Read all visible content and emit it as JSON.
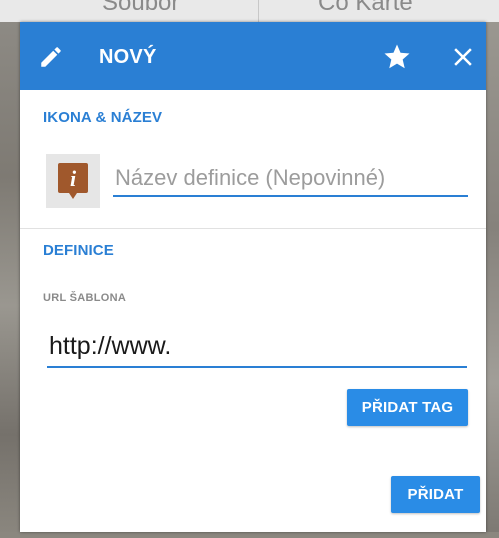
{
  "background": {
    "tab_left": "Soubor",
    "tab_right": "Co Karte"
  },
  "dialog": {
    "title": "NOVÝ",
    "header_icons": {
      "edit": "pencil-icon",
      "favorite": "star-icon",
      "close": "close-icon"
    },
    "icon_and_name": {
      "section_label": "IKONA & NÁZEV",
      "icon": "info-marker-icon",
      "icon_glyph": "i",
      "name_value": "",
      "name_placeholder": "Název definice (Nepovinné)"
    },
    "definition": {
      "section_label": "DEFINICE",
      "url_label": "URL ŠABLONA",
      "url_value": "http://www.",
      "add_tag_label": "PŘIDAT TAG"
    },
    "add_label": "PŘIDAT"
  },
  "colors": {
    "accent": "#2a7fd4",
    "button": "#2a8ce6",
    "marker": "#a0582c"
  }
}
